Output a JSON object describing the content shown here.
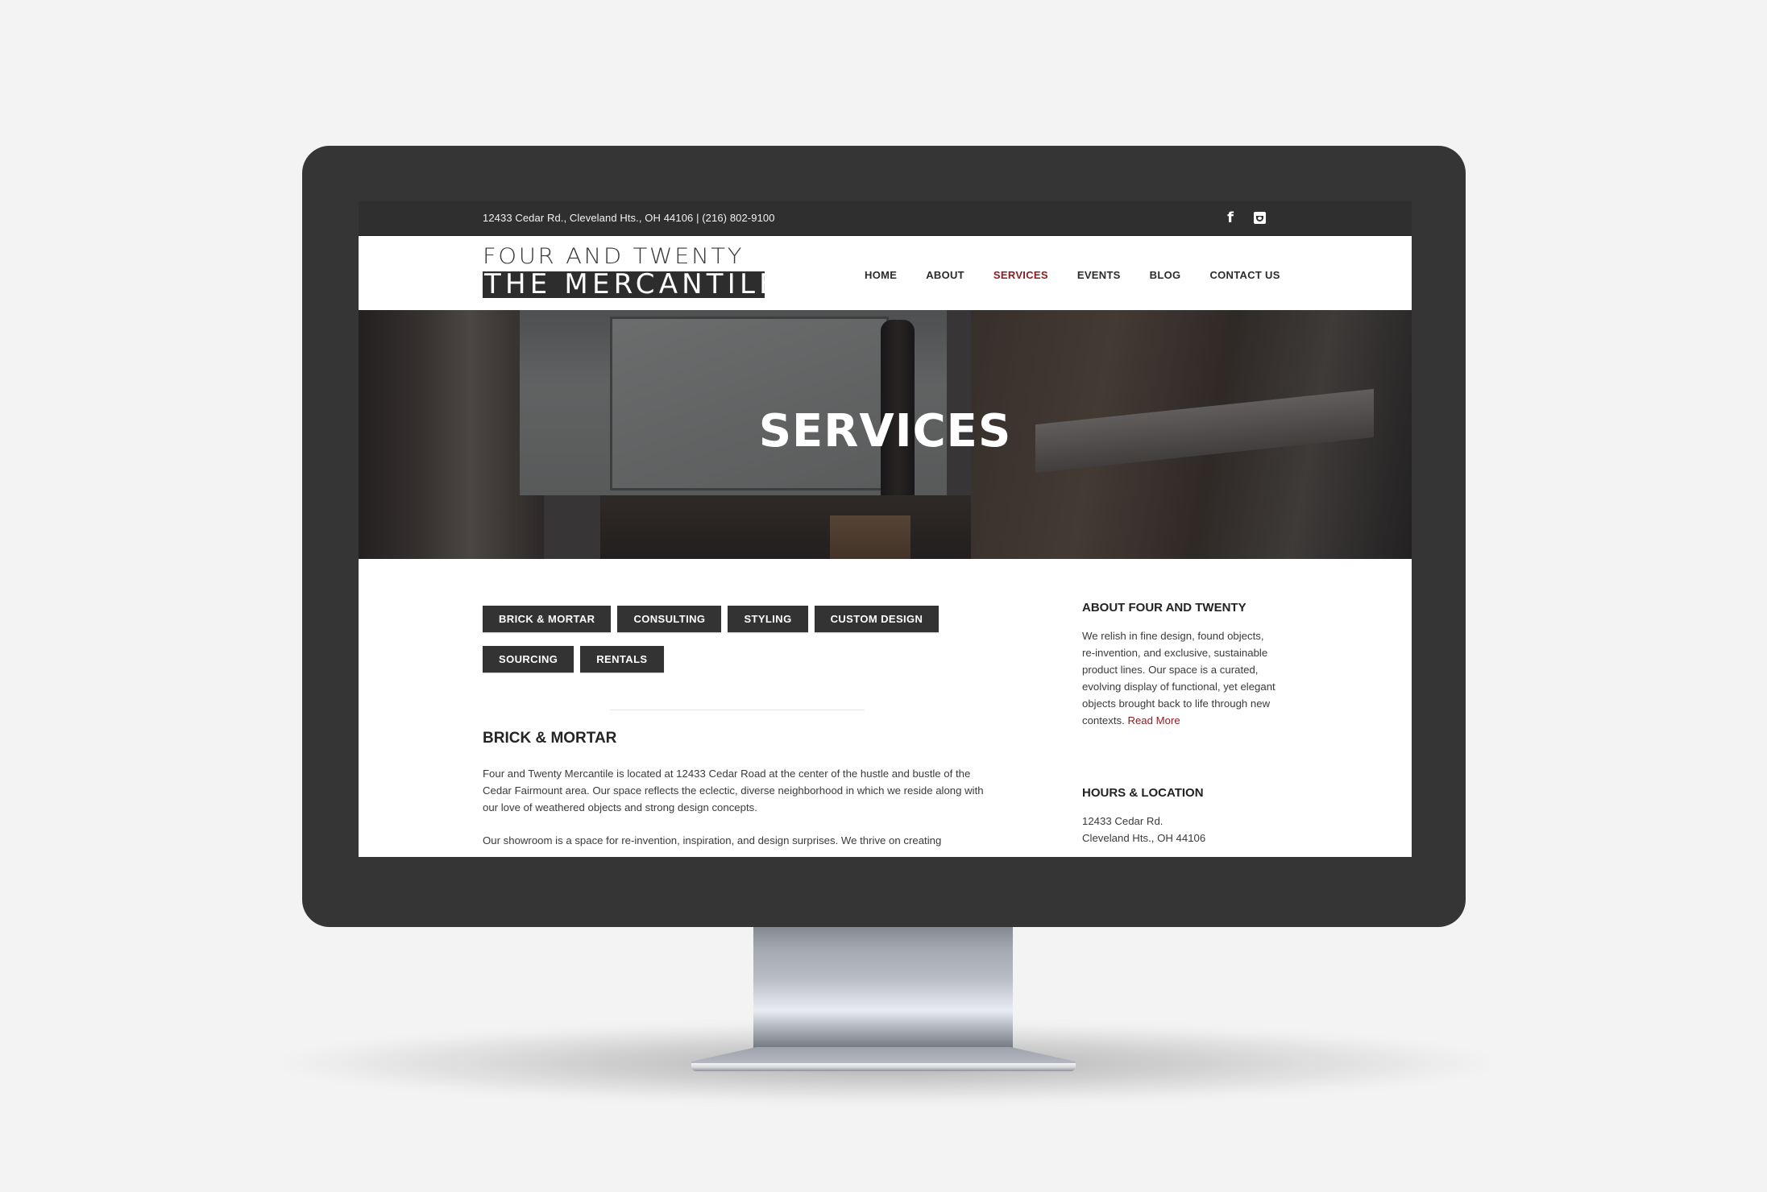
{
  "topbar": {
    "address": "12433 Cedar Rd., Cleveland Hts., OH 44106 | (216) 802-9100",
    "social": [
      {
        "name": "facebook",
        "icon": "f"
      },
      {
        "name": "instagram",
        "icon": "instagram-icon"
      }
    ]
  },
  "logo": {
    "line1": "FOUR AND TWENTY",
    "line2": "THE MERCANTILE"
  },
  "nav": {
    "items": [
      {
        "label": "HOME",
        "active": false
      },
      {
        "label": "ABOUT",
        "active": false
      },
      {
        "label": "SERVICES",
        "active": true
      },
      {
        "label": "EVENTS",
        "active": false
      },
      {
        "label": "BLOG",
        "active": false
      },
      {
        "label": "CONTACT US",
        "active": false
      }
    ],
    "active_color": "#8a1c1e"
  },
  "hero": {
    "title": "SERVICES"
  },
  "service_tabs": {
    "row1": [
      "BRICK & MORTAR",
      "CONSULTING",
      "STYLING",
      "CUSTOM DESIGN"
    ],
    "row2": [
      "SOURCING",
      "RENTALS"
    ]
  },
  "main": {
    "section_title": "BRICK & MORTAR",
    "paragraph1": "Four and Twenty Mercantile is located at 12433 Cedar Road at the center of the hustle and bustle of the Cedar Fairmount area. Our space reflects the eclectic, diverse neighborhood in which we reside along with our love of weathered objects and strong design concepts.",
    "paragraph2": "Our showroom is a space for re-invention, inspiration, and design surprises. We thrive on creating"
  },
  "sidebar": {
    "about_title": "ABOUT FOUR AND TWENTY",
    "about_text": "We relish in fine design, found objects, re-invention, and exclusive, sustainable product lines. Our space is a curated, evolving display of functional, yet elegant objects brought back to life through new contexts.",
    "read_more": "Read More",
    "hours_title": "HOURS & LOCATION",
    "address_line1": "12433 Cedar Rd.",
    "address_line2": "Cleveland Hts., OH 44106"
  },
  "colors": {
    "accent": "#8a1c1e",
    "dark": "#333333",
    "bezel": "#353535",
    "background": "#f3f3f3"
  }
}
